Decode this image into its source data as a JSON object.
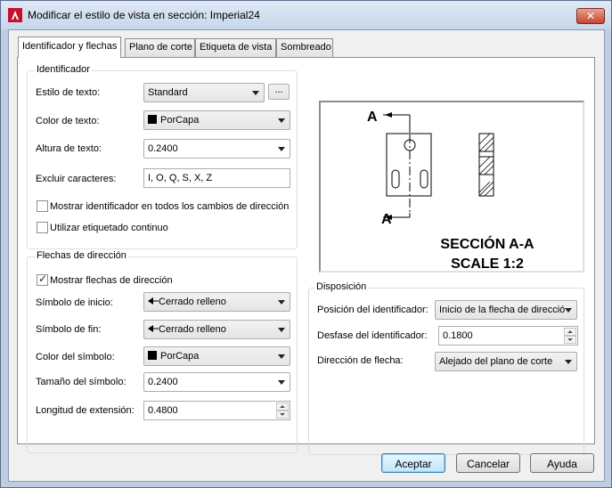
{
  "window": {
    "title": "Modificar el estilo de vista en sección: Imperial24",
    "close_glyph": "✕"
  },
  "tabs": [
    {
      "label": "Identificador y flechas",
      "active": true
    },
    {
      "label": "Plano de corte",
      "active": false
    },
    {
      "label": "Etiqueta de vista",
      "active": false
    },
    {
      "label": "Sombreado",
      "active": false
    }
  ],
  "identificador": {
    "group_label": "Identificador",
    "estilo_texto": {
      "label": "Estilo de texto:",
      "value": "Standard",
      "browse": "..."
    },
    "color_texto": {
      "label": "Color de texto:",
      "value": "PorCapa",
      "swatch": "#000000"
    },
    "altura_texto": {
      "label": "Altura de texto:",
      "value": "0.2400"
    },
    "excluir": {
      "label": "Excluir caracteres:",
      "value": "I, O, Q, S, X, Z"
    },
    "mostrar_identificador": {
      "label": "Mostrar identificador en todos los cambios de dirección",
      "checked": false
    },
    "etiquetado_continuo": {
      "label": "Utilizar etiquetado continuo",
      "checked": false
    }
  },
  "flechas": {
    "group_label": "Flechas de dirección",
    "mostrar_flechas": {
      "label": "Mostrar flechas de dirección",
      "checked": true
    },
    "simbolo_inicio": {
      "label": "Símbolo de inicio:",
      "value": "Cerrado relleno"
    },
    "simbolo_fin": {
      "label": "Símbolo de fin:",
      "value": "Cerrado relleno"
    },
    "color_simbolo": {
      "label": "Color del símbolo:",
      "value": "PorCapa",
      "swatch": "#000000"
    },
    "tamano_simbolo": {
      "label": "Tamaño del símbolo:",
      "value": "0.2400"
    },
    "longitud_extension": {
      "label": "Longitud de extensión:",
      "value": "0.4800"
    }
  },
  "disposicion": {
    "group_label": "Disposición",
    "posicion": {
      "label": "Posición del identificador:",
      "value": "Inicio de la flecha de direcció"
    },
    "desfase": {
      "label": "Desfase del identificador:",
      "value": "0.1800"
    },
    "direccion": {
      "label": "Dirección de flecha:",
      "value": "Alejado del plano de corte"
    }
  },
  "preview": {
    "marker_top": "A",
    "marker_bottom": "A",
    "caption_line1": "SECCIÓN A-A",
    "caption_line2": "SCALE 1:2"
  },
  "buttons": {
    "aceptar": "Aceptar",
    "cancelar": "Cancelar",
    "ayuda": "Ayuda"
  },
  "colors": {
    "accent_default_button": "#3c7fb1",
    "close_button": "#c8432f"
  }
}
